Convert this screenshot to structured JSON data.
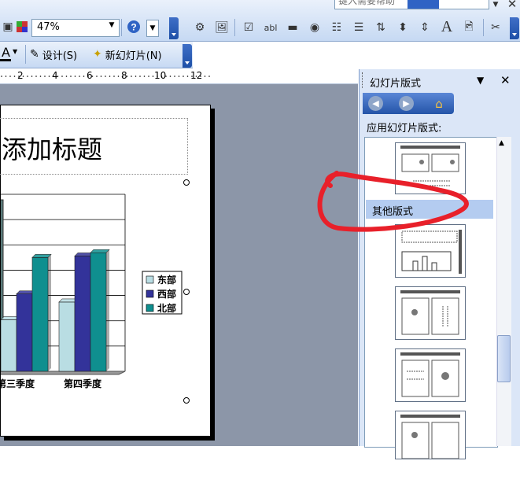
{
  "help_box": {
    "placeholder": "键入需要帮助"
  },
  "toolbar1": {
    "zoom": "47%"
  },
  "toolbar2": {
    "design_label": "设计(S)",
    "new_slide_label": "新幻灯片(N)",
    "font_color_letter": "A"
  },
  "ruler": {
    "labels": [
      "2",
      "4",
      "6",
      "8",
      "10",
      "12"
    ]
  },
  "slide": {
    "title": "添加标题",
    "chart_data": {
      "type": "bar",
      "categories": [
        "第三季度",
        "第四季度"
      ],
      "series": [
        {
          "name": "东部",
          "values": [
            20.4,
            27.4
          ]
        },
        {
          "name": "西部",
          "values": [
            30.6,
            45.6
          ]
        },
        {
          "name": "北部",
          "values": [
            45,
            46.9
          ]
        }
      ],
      "legend": "right",
      "colors": [
        "#b9dde3",
        "#33339a",
        "#0f8f8f"
      ],
      "grid": true
    }
  },
  "panel": {
    "title": "幻灯片版式",
    "apply_label": "应用幻灯片版式:",
    "section_other": "其他版式"
  },
  "colors": {
    "accent": "#1d4fa7",
    "annotation": "#e8202a",
    "workspace": "#8c96a8"
  }
}
